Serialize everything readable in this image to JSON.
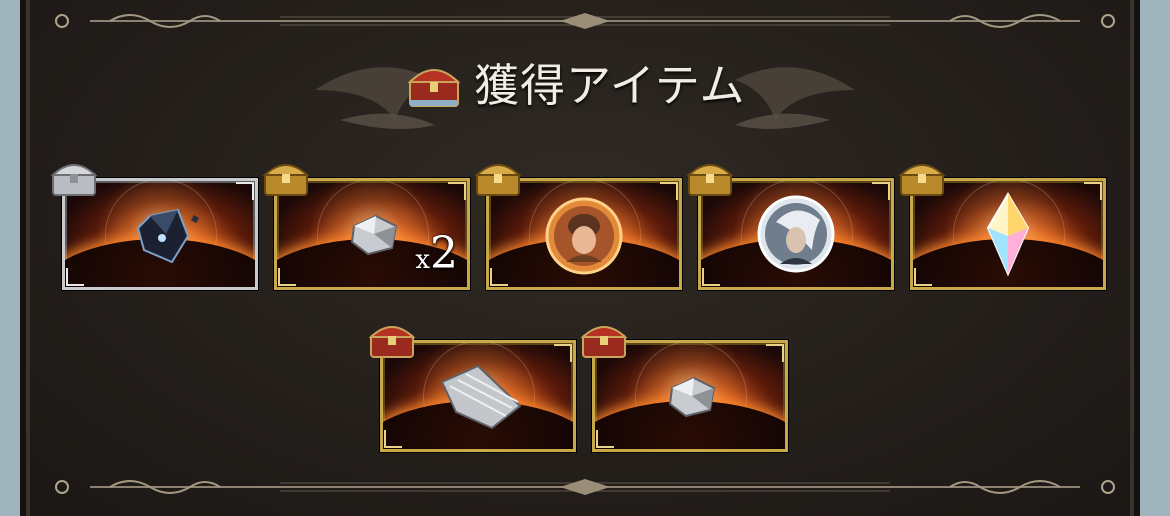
{
  "header": {
    "title": "獲得アイテム",
    "chest_icon": "red-treasure-chest-icon"
  },
  "colors": {
    "panel_bg": "#241f1b",
    "title_text": "#f1ece4",
    "gold_frame": "#c9a84a",
    "silver_frame": "#c7c9cc"
  },
  "items": [
    {
      "frame": "silver",
      "chest": "silver",
      "icon": "dark-crystal-fragment-icon",
      "quantity": ""
    },
    {
      "frame": "gold",
      "chest": "gold",
      "icon": "silver-ore-chunk-icon",
      "quantity": "2"
    },
    {
      "frame": "gold",
      "chest": "gold",
      "icon": "character-portrait-orb-icon",
      "quantity": ""
    },
    {
      "frame": "gold",
      "chest": "gold",
      "icon": "summon-portrait-orb-icon",
      "quantity": ""
    },
    {
      "frame": "gold",
      "chest": "gold",
      "icon": "rainbow-crystal-icon",
      "quantity": ""
    },
    {
      "frame": "gold",
      "chest": "red",
      "icon": "silver-feather-plate-icon",
      "quantity": ""
    },
    {
      "frame": "gold",
      "chest": "red",
      "icon": "silver-ore-chunk-icon",
      "quantity": ""
    }
  ],
  "quantity_prefix": "x"
}
